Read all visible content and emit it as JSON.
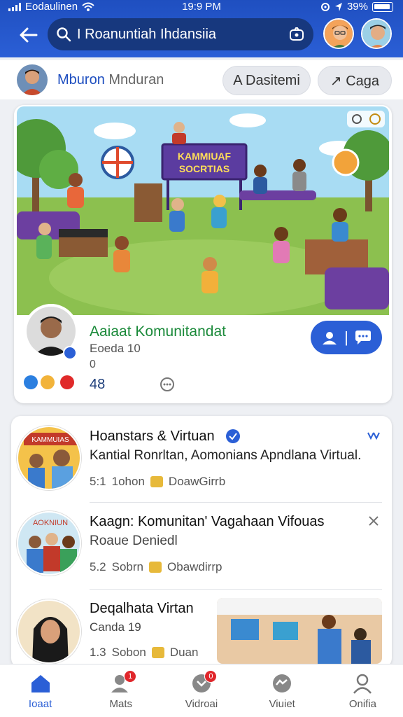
{
  "status_bar": {
    "carrier": "Eodaulinen",
    "time": "19:9 PM",
    "battery": "39%"
  },
  "header": {
    "search_value": "I Roanuntiah Ihdansiia"
  },
  "profile": {
    "name_first": "Mburon",
    "name_second": "Mnduran",
    "pill_1": "A Dasitemi",
    "pill_2": "↗ Caga"
  },
  "featured": {
    "banner_text_line1": "KAMMIUAF",
    "banner_text_line2": "SOCRTIAS",
    "title": "Aaiaat Komunitandat",
    "subtitle": "Eoeda 10",
    "zero": "0",
    "count": "48",
    "join_label": "|"
  },
  "items": [
    {
      "title": "Hoanstars & Virtuan",
      "desc": "Kantial  Ronrltan, Aomonians Apndlana Virtual.",
      "meta_count": "5:1",
      "meta_time": "1ohon",
      "meta_tag": "DoawGirrb",
      "thumb_banner": "KAMMUIAS"
    },
    {
      "title": "Kaagn: Komunitan' Vagahaan Vifouas",
      "desc": "Roaue Deniedl",
      "meta_count": "5.2",
      "meta_time": "Sobrn",
      "meta_tag": "Obawdirrp",
      "thumb_banner": "AOKNIUN"
    },
    {
      "title": "Deqalhata Virtan",
      "desc": "Canda 19",
      "meta_count": "1.3",
      "meta_time": "Sobon",
      "meta_tag": "Duan"
    }
  ],
  "bottom_nav": [
    {
      "label": "Ioaat",
      "active": true,
      "badge": ""
    },
    {
      "label": "Mats",
      "active": false,
      "badge": "1"
    },
    {
      "label": "Vidroai",
      "active": false,
      "badge": "0"
    },
    {
      "label": "Viuiet",
      "active": false,
      "badge": ""
    },
    {
      "label": "Onifia",
      "active": false,
      "badge": ""
    }
  ],
  "colors": {
    "brand": "#2b5fd6",
    "header": "#1f4fc0",
    "title_green": "#1b8a3a"
  }
}
